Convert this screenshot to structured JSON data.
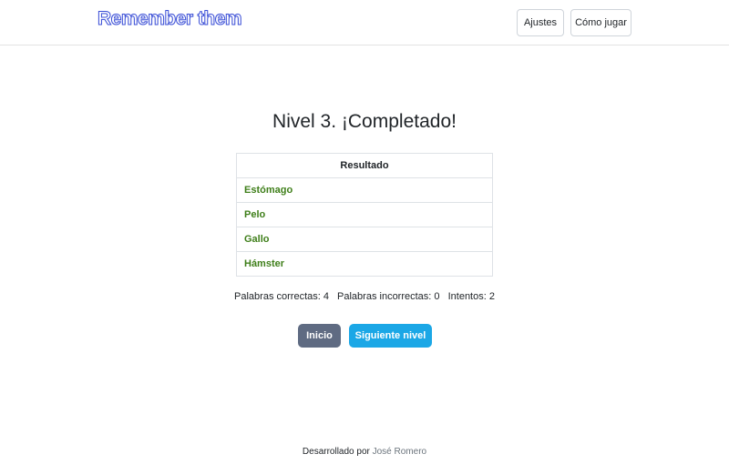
{
  "navbar": {
    "brand": "Remember them",
    "settings_label": "Ajustes",
    "howto_label": "Cómo jugar"
  },
  "main": {
    "title": "Nivel 3. ¡Completado!",
    "table_header": "Resultado",
    "words": [
      "Estómago",
      "Pelo",
      "Gallo",
      "Hámster"
    ],
    "stats": {
      "correct": "Palabras correctas: 4",
      "incorrect": "Palabras incorrectas: 0",
      "attempts": "Intentos: 2"
    },
    "home_label": "Inicio",
    "next_label": "Siguiente nivel"
  },
  "footer": {
    "prefix": "Desarrollado por",
    "author": "José Romero"
  },
  "colors": {
    "correct_word": "#3f7f1a",
    "home_button": "#5f6b82",
    "next_button": "#1ba7e6",
    "brand_outline": "#3b4fd6"
  }
}
